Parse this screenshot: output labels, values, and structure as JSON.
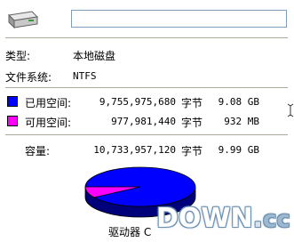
{
  "drive": {
    "icon": "hard-drive-icon",
    "name_value": ""
  },
  "info": {
    "type_label": "类型:",
    "type_value": "本地磁盘",
    "fs_label": "文件系统:",
    "fs_value": "NTFS"
  },
  "usage": {
    "used": {
      "label": "已用空间:",
      "bytes": "9,755,975,680",
      "unit": "字节",
      "human": "9.08 GB",
      "color": "#0000ff"
    },
    "free": {
      "label": "可用空间:",
      "bytes": "977,981,440",
      "unit": "字节",
      "human": "932 MB",
      "color": "#ff00ff"
    },
    "capacity": {
      "label": "容量:",
      "bytes": "10,733,957,120",
      "unit": "字节",
      "human": "9.99 GB"
    }
  },
  "pie": {
    "used_fraction": 0.909,
    "free_fraction": 0.091
  },
  "drive_label": "驱动器 C",
  "watermark": {
    "text": "DOWN",
    "dot": ".",
    "tld": "cc"
  }
}
